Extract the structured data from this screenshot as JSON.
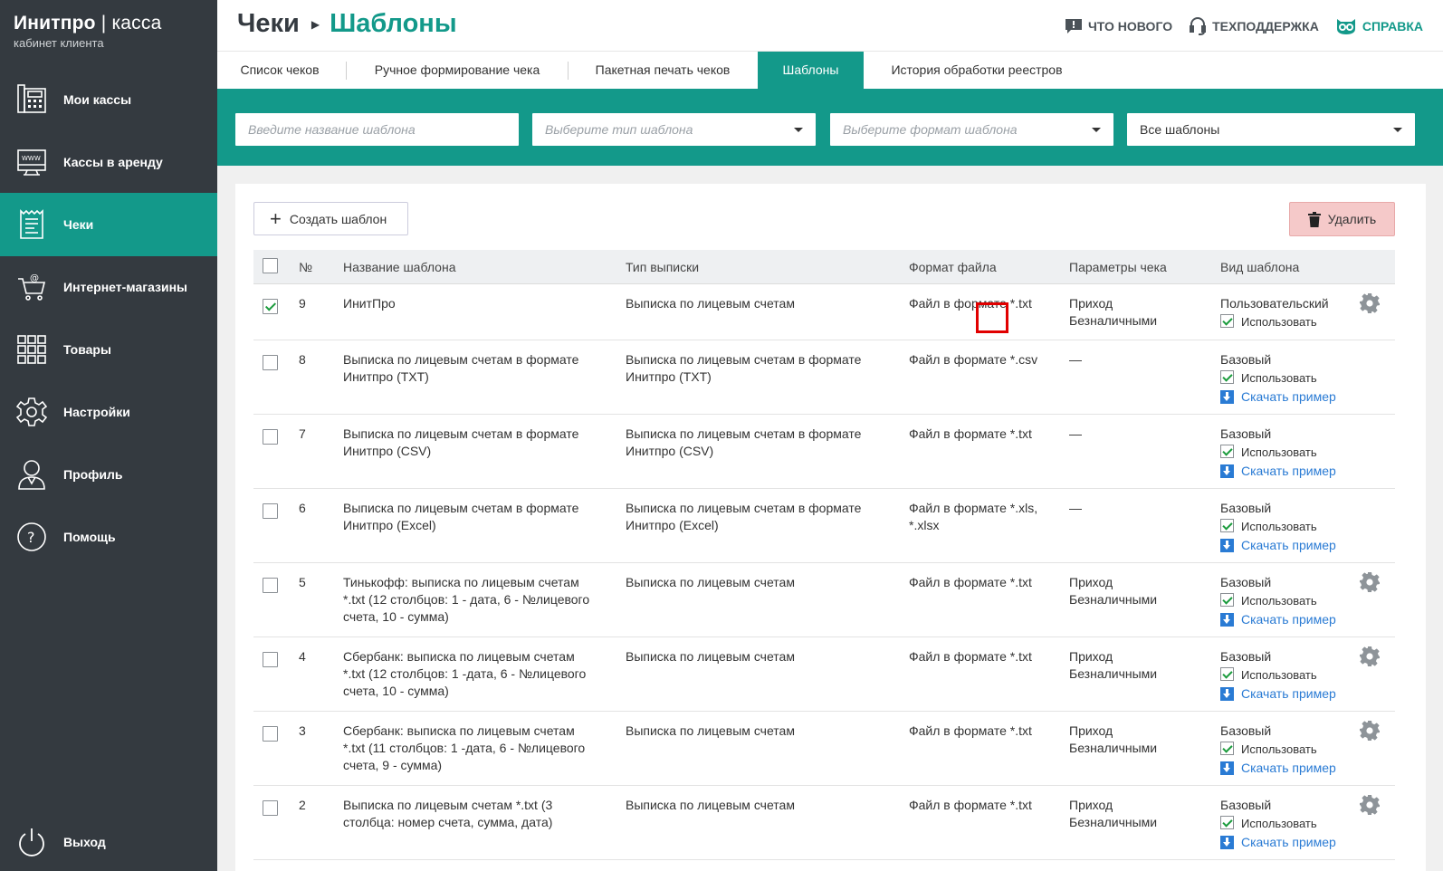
{
  "brand": {
    "title_bold": "Инитпро",
    "title_sep": " | ",
    "title_light": "касса",
    "subtitle": "кабинет клиента"
  },
  "sidebar": {
    "items": [
      {
        "label": "Мои кассы",
        "icon": "cash-register-icon",
        "active": false
      },
      {
        "label": "Кассы в аренду",
        "icon": "www-monitor-icon",
        "active": false
      },
      {
        "label": "Чеки",
        "icon": "receipt-icon",
        "active": true
      },
      {
        "label": "Интернет-магазины",
        "icon": "shopping-cart-icon",
        "active": false
      },
      {
        "label": "Товары",
        "icon": "grid-icon",
        "active": false
      },
      {
        "label": "Настройки",
        "icon": "gear-icon",
        "active": false
      },
      {
        "label": "Профиль",
        "icon": "user-icon",
        "active": false
      },
      {
        "label": "Помощь",
        "icon": "help-icon",
        "active": false
      }
    ],
    "logout": "Выход"
  },
  "header": {
    "crumb_parent": "Чеки",
    "crumb_current": "Шаблоны",
    "links": {
      "news": "ЧТО НОВОГО",
      "support": "ТЕХПОДДЕРЖКА",
      "help": "СПРАВКА"
    }
  },
  "tabs": [
    "Список чеков",
    "Ручное формирование чека",
    "Пакетная печать чеков",
    "Шаблоны",
    "История обработки реестров"
  ],
  "filters": {
    "name_placeholder": "Введите название шаблона",
    "type_placeholder": "Выберите тип шаблона",
    "format_placeholder": "Выберите формат шаблона",
    "scope_value": "Все шаблоны"
  },
  "actions": {
    "create": "Создать шаблон",
    "delete": "Удалить"
  },
  "table": {
    "headers": {
      "num": "№",
      "name": "Название шаблона",
      "type": "Тип выписки",
      "format": "Формат файла",
      "params": "Параметры чека",
      "kind": "Вид шаблона"
    },
    "use_label": "Использовать",
    "download_label": "Скачать пример",
    "rows": [
      {
        "checked": true,
        "num": "9",
        "name": [
          "ИнитПро"
        ],
        "type": [
          "Выписка по лицевым счетам"
        ],
        "format": [
          "Файл в формате *.txt"
        ],
        "params": [
          "Приход",
          "Безналичными"
        ],
        "kind": "Пользовательский",
        "download": false,
        "gear": true
      },
      {
        "checked": false,
        "num": "8",
        "name": [
          "Выписка по лицевым счетам в формате",
          "Инитпро (TXT)"
        ],
        "type": [
          "Выписка по лицевым счетам в формате",
          "Инитпро (TXT)"
        ],
        "format": [
          "Файл в формате *.csv"
        ],
        "params": [
          "—"
        ],
        "kind": "Базовый",
        "download": true,
        "gear": false
      },
      {
        "checked": false,
        "num": "7",
        "name": [
          "Выписка по лицевым счетам в формате",
          "Инитпро (CSV)"
        ],
        "type": [
          "Выписка по лицевым счетам в формате",
          "Инитпро (CSV)"
        ],
        "format": [
          "Файл в формате *.txt"
        ],
        "params": [
          "—"
        ],
        "kind": "Базовый",
        "download": true,
        "gear": false
      },
      {
        "checked": false,
        "num": "6",
        "name": [
          "Выписка по лицевым счетам в формате",
          "Инитпро (Excel)"
        ],
        "type": [
          "Выписка по лицевым счетам в формате",
          "Инитпро (Excel)"
        ],
        "format": [
          "Файл в формате *.xls,",
          "*.xlsx"
        ],
        "params": [
          "—"
        ],
        "kind": "Базовый",
        "download": true,
        "gear": false
      },
      {
        "checked": false,
        "num": "5",
        "name": [
          "Тинькофф: выписка по лицевым счетам",
          "*.txt (12 столбцов: 1 - дата, 6 - №лицевого",
          "счета, 10 - сумма)"
        ],
        "type": [
          "Выписка по лицевым счетам"
        ],
        "format": [
          "Файл в формате *.txt"
        ],
        "params": [
          "Приход",
          "Безналичными"
        ],
        "kind": "Базовый",
        "download": true,
        "gear": true
      },
      {
        "checked": false,
        "num": "4",
        "name": [
          "Сбербанк: выписка по лицевым счетам",
          "*.txt (12 столбцов: 1 -дата, 6 - №лицевого",
          "счета, 10 - сумма)"
        ],
        "type": [
          "Выписка по лицевым счетам"
        ],
        "format": [
          "Файл в формате *.txt"
        ],
        "params": [
          "Приход",
          "Безналичными"
        ],
        "kind": "Базовый",
        "download": true,
        "gear": true
      },
      {
        "checked": false,
        "num": "3",
        "name": [
          "Сбербанк: выписка по лицевым счетам",
          "*.txt (11 столбцов: 1 -дата, 6 - №лицевого",
          "счета, 9 - сумма)"
        ],
        "type": [
          "Выписка по лицевым счетам"
        ],
        "format": [
          "Файл в формате *.txt"
        ],
        "params": [
          "Приход",
          "Безналичными"
        ],
        "kind": "Базовый",
        "download": true,
        "gear": true
      },
      {
        "checked": false,
        "num": "2",
        "name": [
          "Выписка по лицевым счетам *.txt (3",
          "столбца: номер счета, сумма, дата)"
        ],
        "type": [
          "Выписка по лицевым счетам"
        ],
        "format": [
          "Файл в формате *.txt"
        ],
        "params": [
          "Приход",
          "Безналичными"
        ],
        "kind": "Базовый",
        "download": true,
        "gear": true
      }
    ]
  },
  "colors": {
    "teal": "#13998a",
    "sidebar": "#343a40",
    "link": "#2a7bd4",
    "delete_bg": "#f5c9c9",
    "highlight": "#e10000"
  }
}
